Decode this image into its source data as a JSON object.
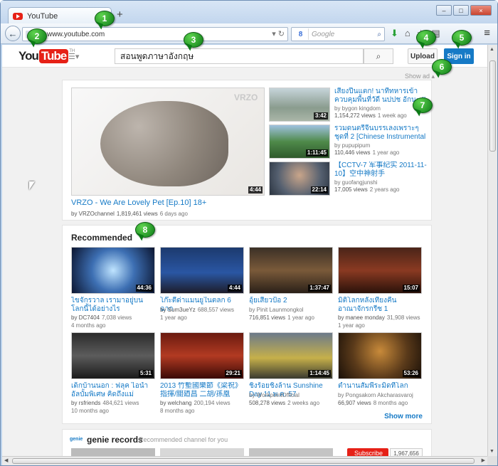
{
  "browser": {
    "tab_title": "YouTube",
    "tab_close": "×",
    "new_tab": "+",
    "url": "www.youtube.com",
    "search_engine_placeholder": "Google",
    "win_min": "–",
    "win_max": "□",
    "win_close": "×"
  },
  "youtube": {
    "logo_you": "You",
    "logo_tube": "Tube",
    "logo_tm": "TH",
    "search_query": "สอนพูดภาษาอังกฤษ",
    "upload_label": "Upload",
    "signin_label": "Sign in",
    "show_ad": "Show ad ▴"
  },
  "featured": {
    "main": {
      "title": "VRZO - We Are Lovely Pet [Ep.10] 18+",
      "channel": "by VRZOchannel",
      "views": "1,819,461 views",
      "age": "6 days ago",
      "duration": "4:44",
      "watermark": "VRZO"
    },
    "side": [
      {
        "title": "เสียงปืนแตก! นาทีทหารเข้าควบคุมพื้นที่วัดี นปปช อักนะ !!",
        "channel": "by bygon kingdom",
        "views": "1,154,272 views",
        "age": "1 week ago",
        "duration": "3:42"
      },
      {
        "title": "รวมดนตรีจีนบรรเลงเพราะๆ ชุดที่ 2 [Chinese Instrumental",
        "channel": "by pupupipum",
        "views": "110,446 views",
        "age": "1 year ago",
        "duration": "1:11:45"
      },
      {
        "title": "【CCTV-7 军事纪实 2011-11-10】空中神射手",
        "channel": "by guofangjunshi",
        "views": "17,005 views",
        "age": "2 years ago",
        "duration": "22:14"
      }
    ]
  },
  "recommended": {
    "heading": "Recommended",
    "show_more": "Show more",
    "videos": [
      {
        "title": "ไขจักรวาล เรามาอยู่บนโลกนี้ได้อย่างไร",
        "channel": "by DC7404",
        "views": "7,038 views",
        "age": "4 months ago",
        "duration": "44:36"
      },
      {
        "title": "โก๊ะตี๋ด่าแมนยูในตลก 6 ฉาก",
        "channel": "by Sum3ueYz",
        "views": "688,557 views",
        "age": "1 year ago",
        "duration": "4:44"
      },
      {
        "title": "อุ้ยเสี่ยวป้อ 2",
        "channel": "by Pinit Launmongkol",
        "views": "716,851 views",
        "age": "1 year ago",
        "duration": "1:37:47"
      },
      {
        "title": "มิติโลกหลังเที่ยงคืน อาณาจักรกรีซ 1",
        "channel": "by manee monday",
        "views": "31,908 views",
        "age": "1 year ago",
        "duration": "15:07"
      },
      {
        "title": "เด็กบ้านนอก : ฟลุค ไอน้ำ อัลบั้มพิเศษ คิดถึงแม่ [Offici...",
        "channel": "by rsfriends",
        "views": "484,621 views",
        "age": "10 months ago",
        "duration": "5:31"
      },
      {
        "title": "2013 竹塹國樂節《梁祝》指揮/關廼昌 二胡/孫凰",
        "channel": "by welchang",
        "views": "200,194 views",
        "age": "8 months ago",
        "duration": "29:21"
      },
      {
        "title": "ชิงร้อยชิงล้าน Sunshine Day 11 พ.ค. 57",
        "channel": "by WorkpointOfficial",
        "views": "508,278 views",
        "age": "2 weeks ago",
        "duration": "1:14:45"
      },
      {
        "title": "ตำนานสัมพีระมิดที่โลกตะลึง",
        "channel": "by Pongsakorn Akcharasvaroj",
        "views": "66,907 views",
        "age": "8 months ago",
        "duration": "53:26"
      }
    ]
  },
  "genie": {
    "logo": "genie",
    "name": "genie records",
    "sub": "Recommended channel for you",
    "subscribe": "Subscribe",
    "count": "1,967,656"
  },
  "callouts": [
    "1",
    "2",
    "3",
    "4",
    "5",
    "6",
    "7",
    "8"
  ]
}
